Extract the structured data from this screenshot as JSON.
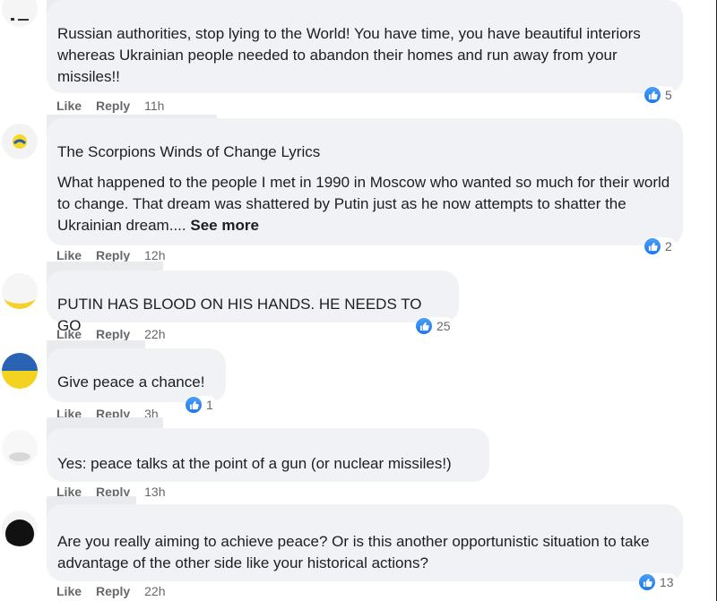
{
  "colors": {
    "bubble_bg": "#f0f2f5",
    "text": "#1c1e21",
    "meta": "#65676b",
    "like_blue": "#1877f2"
  },
  "icons": {
    "reaction": "thumbs-up-icon"
  },
  "comments": [
    {
      "text": "Russian authorities, stop lying to the World! You have time, you have beautiful interiors whereas Ukrainian people needed to abandon their homes and run away from your missiles!!",
      "like": "Like",
      "reply": "Reply",
      "time": "11h",
      "reactions": "5"
    },
    {
      "title": "The Scorpions Winds of Change Lyrics",
      "text": "What happened to the people I met in 1990 in Moscow who wanted so much for their world to change. That dream was shattered by Putin just as he now attempts to shatter the Ukrainian dream....",
      "see_more": "See more",
      "like": "Like",
      "reply": "Reply",
      "time": "12h",
      "reactions": "2"
    },
    {
      "text": "PUTIN HAS BLOOD ON HIS HANDS. HE NEEDS TO GO",
      "like": "Like",
      "reply": "Reply",
      "time": "22h",
      "reactions": "25"
    },
    {
      "text": "Give peace a chance!",
      "like": "Like",
      "reply": "Reply",
      "time": "3h",
      "reactions": "1"
    },
    {
      "text": "Yes: peace talks at the point of a gun (or nuclear missiles!)",
      "like": "Like",
      "reply": "Reply",
      "time": "13h",
      "reactions": ""
    },
    {
      "text": "Are you really aiming to achieve peace? Or is this another opportunistic situation to take advantage of the other side like your historical actions?",
      "like": "Like",
      "reply": "Reply",
      "time": "22h",
      "reactions": "13"
    }
  ]
}
